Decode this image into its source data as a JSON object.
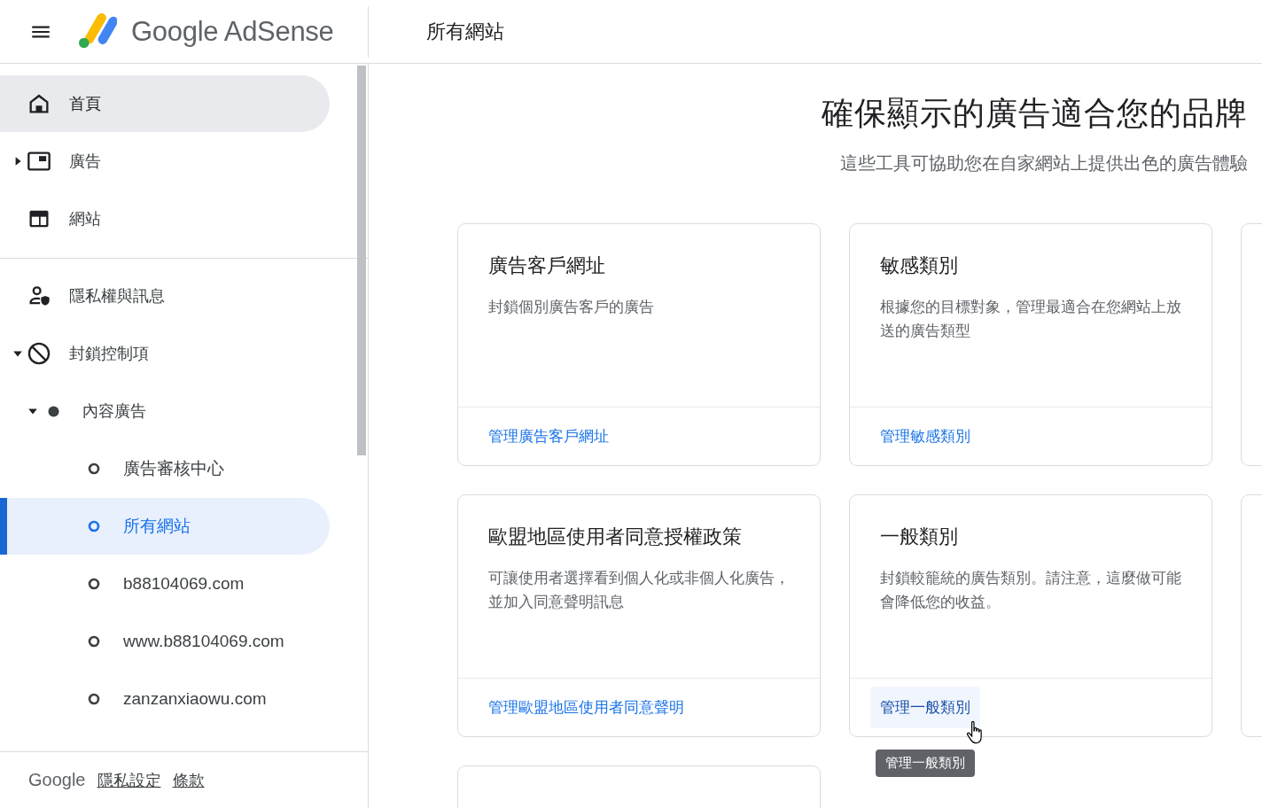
{
  "header": {
    "product": "Google AdSense",
    "page_title": "所有網站"
  },
  "nav": {
    "sections": [
      {
        "items": [
          {
            "label": "首頁",
            "highlighted": true,
            "selected": false
          },
          {
            "label": "廣告",
            "highlighted": false,
            "selected": false,
            "expanded": false
          },
          {
            "label": "網站",
            "highlighted": false,
            "selected": false
          }
        ]
      },
      {
        "items": [
          {
            "label": "隱私權與訊息",
            "highlighted": false,
            "selected": false
          },
          {
            "label": "封鎖控制項",
            "highlighted": false,
            "selected": false,
            "expanded": true,
            "children": [
              {
                "label": "內容廣告",
                "highlighted": false,
                "selected": false,
                "expanded": true,
                "children": [
                  {
                    "label": "廣告審核中心",
                    "highlighted": false,
                    "selected": false
                  },
                  {
                    "label": "所有網站",
                    "highlighted": false,
                    "selected": true
                  },
                  {
                    "label": "b88104069.com",
                    "highlighted": false,
                    "selected": false
                  },
                  {
                    "label": "www.b88104069.com",
                    "highlighted": false,
                    "selected": false
                  },
                  {
                    "label": "zanzanxiaowu.com",
                    "highlighted": false,
                    "selected": false
                  }
                ]
              }
            ]
          }
        ]
      }
    ]
  },
  "footer": {
    "brand": "Google",
    "links": [
      "隱私設定",
      "條款"
    ]
  },
  "main": {
    "title": "確保顯示的廣告適合您的品牌",
    "subtitle": "這些工具可協助您在自家網站上提供出色的廣告體驗",
    "cards": [
      {
        "title": "廣告客戶網址",
        "description": "封鎖個別廣告客戶的廣告",
        "link": "管理廣告客戶網址",
        "link_hovered": false
      },
      {
        "title": "敏感類別",
        "description": "根據您的目標對象，管理最適合在您網站上放送的廣告類型",
        "link": "管理敏感類別",
        "link_hovered": false
      },
      {
        "title": "歐盟地區使用者同意授權政策",
        "description": "可讓使用者選擇看到個人化或非個人化廣告，並加入同意聲明訊息",
        "link": "管理歐盟地區使用者同意聲明",
        "link_hovered": false
      },
      {
        "title": "一般類別",
        "description": "封鎖較籠統的廣告類別。請注意，這麼做可能會降低您的收益。",
        "link": "管理一般類別",
        "link_hovered": true,
        "tooltip": "管理一般類別"
      }
    ]
  }
}
